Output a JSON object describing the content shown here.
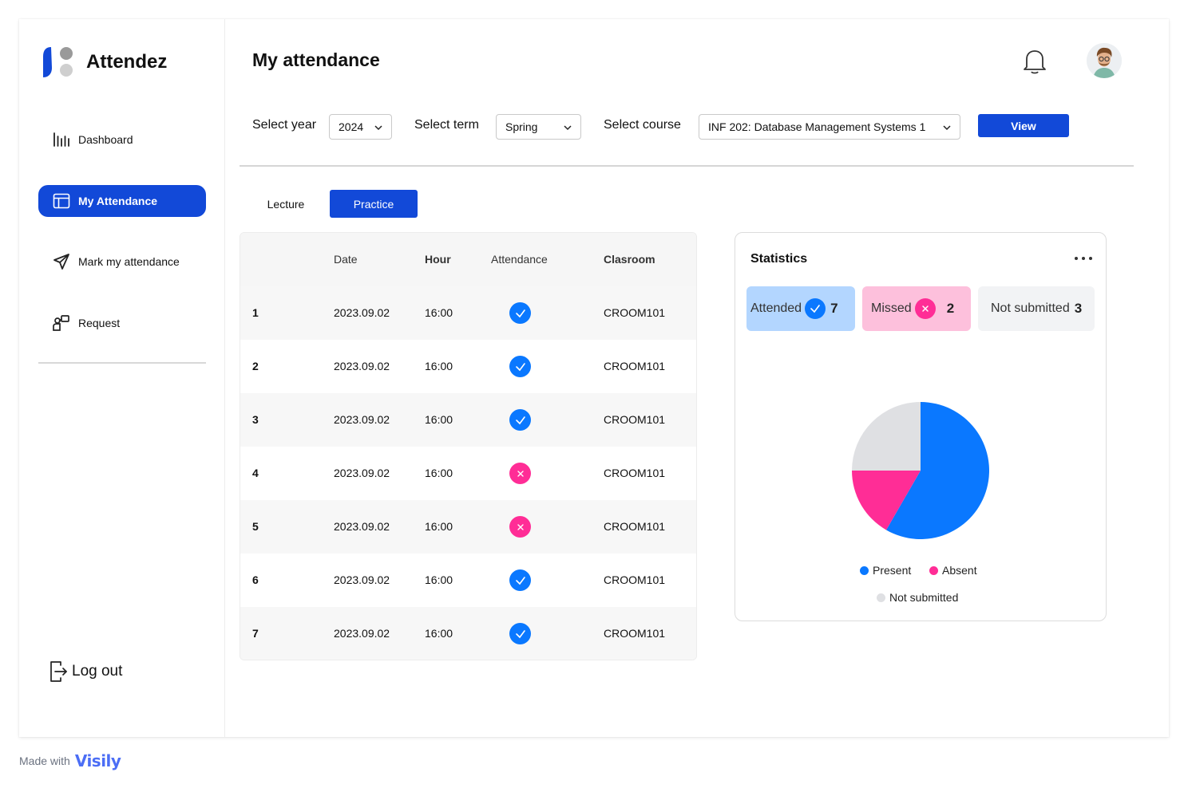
{
  "app": {
    "name": "Attendez"
  },
  "sidebar": {
    "items": [
      {
        "label": "Dashboard",
        "icon": "bar-chart-icon",
        "active": false
      },
      {
        "label": "My Attendance",
        "icon": "layout-icon",
        "active": true
      },
      {
        "label": "Mark my attendance",
        "icon": "send-icon",
        "active": false
      },
      {
        "label": "Request",
        "icon": "request-icon",
        "active": false
      }
    ],
    "logout_label": "Log out"
  },
  "header": {
    "title": "My attendance"
  },
  "filters": {
    "year_label": "Select year",
    "year_value": "2024",
    "term_label": "Select term",
    "term_value": "Spring",
    "course_label": "Select course",
    "course_value": "INF 202: Database Management Systems 1",
    "view_label": "View"
  },
  "tabs": [
    {
      "label": "Lecture",
      "active": false
    },
    {
      "label": "Practice",
      "active": true
    }
  ],
  "table": {
    "columns": [
      "",
      "Date",
      "Hour",
      "Attendance",
      "Clasroom"
    ],
    "rows": [
      {
        "num": "1",
        "date": "2023.09.02",
        "hour": "16:00",
        "attended": true,
        "room": "CROOM101"
      },
      {
        "num": "2",
        "date": "2023.09.02",
        "hour": "16:00",
        "attended": true,
        "room": "CROOM101"
      },
      {
        "num": "3",
        "date": "2023.09.02",
        "hour": "16:00",
        "attended": true,
        "room": "CROOM101"
      },
      {
        "num": "4",
        "date": "2023.09.02",
        "hour": "16:00",
        "attended": false,
        "room": "CROOM101"
      },
      {
        "num": "5",
        "date": "2023.09.02",
        "hour": "16:00",
        "attended": false,
        "room": "CROOM101"
      },
      {
        "num": "6",
        "date": "2023.09.02",
        "hour": "16:00",
        "attended": true,
        "room": "CROOM101"
      },
      {
        "num": "7",
        "date": "2023.09.02",
        "hour": "16:00",
        "attended": true,
        "room": "CROOM101"
      }
    ]
  },
  "stats": {
    "title": "Statistics",
    "attended_label": "Attended",
    "attended_count": "7",
    "missed_label": "Missed",
    "missed_count": "2",
    "not_submitted_label": "Not submitted",
    "not_submitted_count": "3"
  },
  "chart_data": {
    "type": "pie",
    "categories": [
      "Present",
      "Absent",
      "Not submitted"
    ],
    "values": [
      7,
      2,
      3
    ],
    "colors": [
      "#0a78ff",
      "#ff2d96",
      "#dfe0e3"
    ],
    "legend": [
      "Present",
      "Absent",
      "Not submitted"
    ]
  },
  "colors": {
    "primary": "#1249d8",
    "present": "#0a78ff",
    "absent": "#ff2d96"
  },
  "footer": {
    "made_with": "Made with",
    "brand": "Visily"
  }
}
